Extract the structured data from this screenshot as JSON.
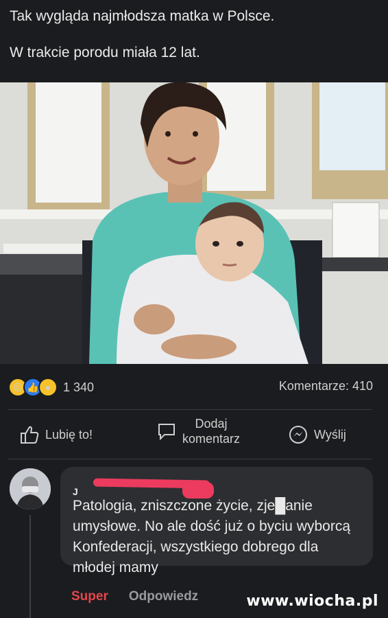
{
  "post": {
    "line1": "Tak wygląda najmłodsza matka w Polsce.",
    "line2": "W trakcie porodu miała 12 lat."
  },
  "stats": {
    "reaction_count": "1 340",
    "comments_label": "Komentarze: 410",
    "reaction_icons": [
      "sad-reaction-icon",
      "like-reaction-icon",
      "wow-reaction-icon"
    ]
  },
  "actions": {
    "like_label": "Lubię to!",
    "comment_label_top": "Dodaj",
    "comment_label_bottom": "komentarz",
    "share_label": "Wyślij"
  },
  "comment": {
    "author_initial": "J",
    "text": "Patologia, zniszczone życie, zje█anie umysłowe. No ale dość już o byciu wyborcą Konfederacji, wszystkiego dobrego dla młodej mamy",
    "super_label": "Super",
    "reply_label": "Odpowiedz"
  },
  "watermark": "www.wiocha.pl",
  "colors": {
    "background": "#1b1c1f",
    "bubble": "#2d2e31",
    "super": "#e5474d",
    "redaction": "#ec3b5f"
  }
}
